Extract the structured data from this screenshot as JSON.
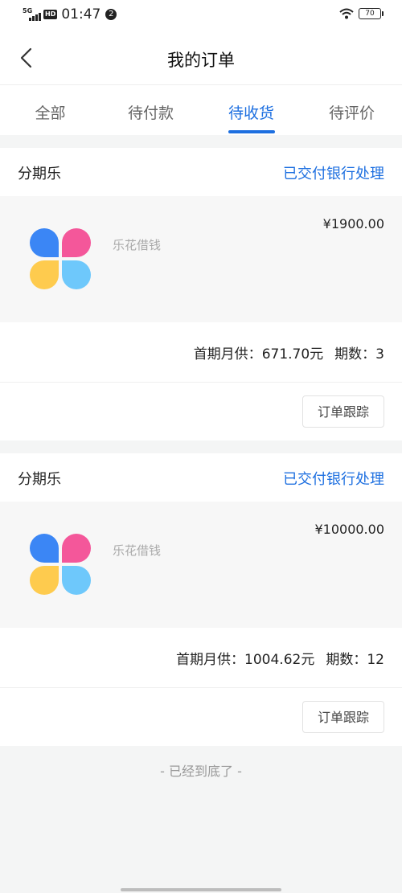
{
  "status_bar": {
    "network": "5G",
    "hd": "HD",
    "time": "01:47",
    "notification_count": "2",
    "battery": "70"
  },
  "header": {
    "title": "我的订单"
  },
  "tabs": [
    {
      "label": "全部",
      "active": false
    },
    {
      "label": "待付款",
      "active": false
    },
    {
      "label": "待收货",
      "active": true
    },
    {
      "label": "待评价",
      "active": false
    }
  ],
  "orders": [
    {
      "merchant": "分期乐",
      "status": "已交付银行处理",
      "product_name": "乐花借钱",
      "price": "¥1900.00",
      "first_payment_label": "首期月供：",
      "first_payment": "671.70元",
      "periods_label": "期数：",
      "periods": "3",
      "track_label": "订单跟踪"
    },
    {
      "merchant": "分期乐",
      "status": "已交付银行处理",
      "product_name": "乐花借钱",
      "price": "¥10000.00",
      "first_payment_label": "首期月供：",
      "first_payment": "1004.62元",
      "periods_label": "期数：",
      "periods": "12",
      "track_label": "订单跟踪"
    }
  ],
  "footer": {
    "end_text": "- 已经到底了 -"
  },
  "colors": {
    "accent": "#1d6fe0",
    "logo_blue": "#3b86f5",
    "logo_pink": "#f4579a",
    "logo_yellow": "#fecb4e",
    "logo_lightblue": "#6ec8fb"
  },
  "icons": {
    "back": "chevron-left-icon",
    "wifi": "wifi-icon",
    "battery": "battery-icon",
    "logo": "four-leaf-logo"
  }
}
